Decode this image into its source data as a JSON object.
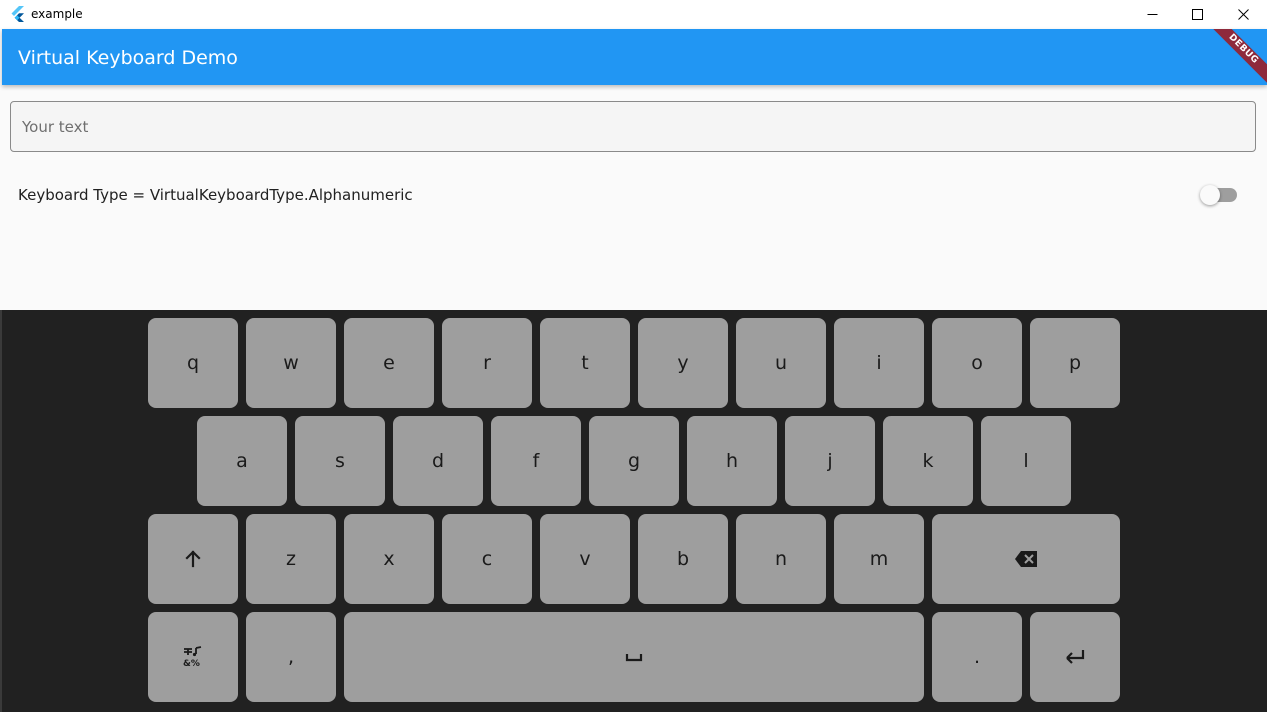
{
  "window": {
    "title": "example"
  },
  "appbar": {
    "title": "Virtual Keyboard Demo",
    "debug_banner": "DEBUG",
    "color": "#2196f3"
  },
  "text_field": {
    "placeholder": "Your text",
    "value": ""
  },
  "keyboard_type": {
    "label": "Keyboard Type = VirtualKeyboardType.Alphanumeric",
    "switch_on": false
  },
  "keyboard": {
    "background": "#212121",
    "key_color": "#9e9e9e",
    "row1": [
      "q",
      "w",
      "e",
      "r",
      "t",
      "y",
      "u",
      "i",
      "o",
      "p"
    ],
    "row2": [
      "a",
      "s",
      "d",
      "f",
      "g",
      "h",
      "j",
      "k",
      "l"
    ],
    "row3": [
      "z",
      "x",
      "c",
      "v",
      "b",
      "n",
      "m"
    ],
    "row4": {
      "comma": ",",
      "period": "."
    },
    "icons": {
      "shift": "shift-arrow-up-icon",
      "backspace": "backspace-icon",
      "symbols": "symbols-toggle-icon",
      "space": "space-bar-icon",
      "enter": "enter-return-icon"
    }
  }
}
